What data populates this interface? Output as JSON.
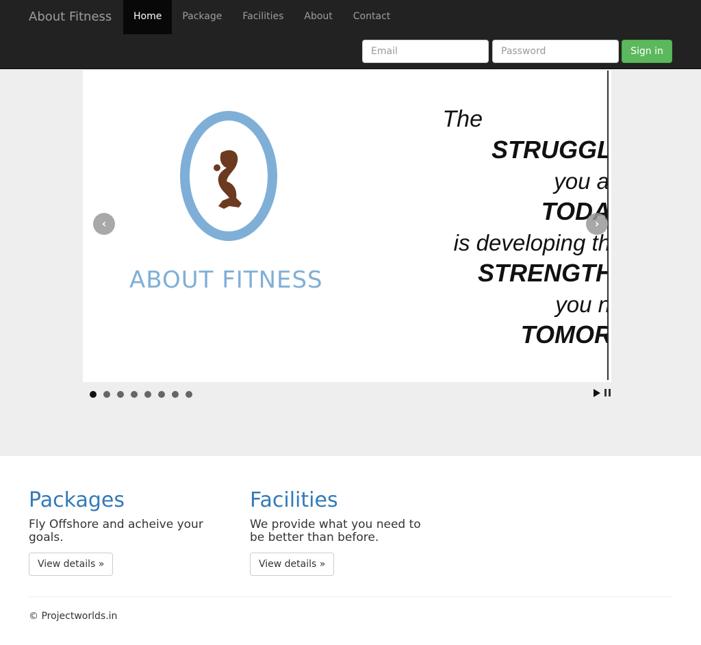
{
  "brand": "About Fitness",
  "nav": {
    "items": [
      "Home",
      "Package",
      "Facilities",
      "About",
      "Contact"
    ],
    "active": "Home"
  },
  "signin_form": {
    "email_placeholder": "Email",
    "password_placeholder": "Password",
    "button_label": "Sign in"
  },
  "carousel": {
    "slide": {
      "logo_text": "ABOUT FITNESS",
      "quote_lines": [
        "The",
        "STRUGGL",
        "you a",
        "TODA",
        "is developing th",
        "STRENGTH",
        "you n",
        "TOMOR"
      ]
    },
    "prev_icon": "chevron-left-icon",
    "next_icon": "chevron-right-icon",
    "prev_glyph": "‹",
    "next_glyph": "›",
    "indicator_count": 8,
    "active_indicator": 1
  },
  "features": [
    {
      "title": "Packages",
      "text": "Fly Offshore and acheive your goals.",
      "button": "View details »"
    },
    {
      "title": "Facilities",
      "text": "We provide what you need to be better than before.",
      "button": "View details »"
    }
  ],
  "footer": {
    "text": "© Projectworlds.in"
  },
  "colors": {
    "navbar": "#222222",
    "accent": "#337ab7",
    "success": "#5cb85c",
    "logo_blue": "#7fafd6",
    "logo_brown": "#6b3a1f"
  }
}
